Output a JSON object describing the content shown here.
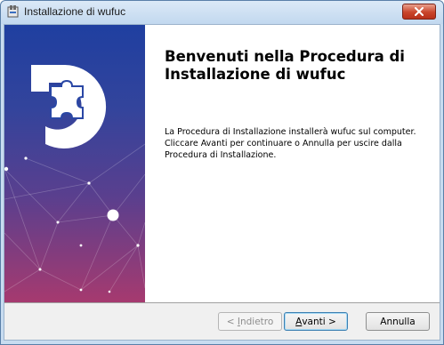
{
  "window": {
    "title": "Installazione di wufuc",
    "close_glyph": "✕"
  },
  "banner": {
    "logo": "wufuc-puzzle-logo",
    "gradient_top": "#1f3fa0",
    "gradient_bottom": "#a63a6f"
  },
  "content": {
    "heading_line1": "Benvenuti nella Procedura di",
    "heading_line2": "Installazione di wufuc",
    "body_line1": "La Procedura di Installazione installerà wufuc sul computer.",
    "body_line2": "Cliccare Avanti per continuare o Annulla per uscire dalla",
    "body_line3": "Procedura di Installazione."
  },
  "buttons": {
    "back_prefix": "< ",
    "back_accel": "I",
    "back_rest": "ndietro",
    "next_accel": "A",
    "next_rest": "vanti >",
    "cancel": "Annulla"
  }
}
